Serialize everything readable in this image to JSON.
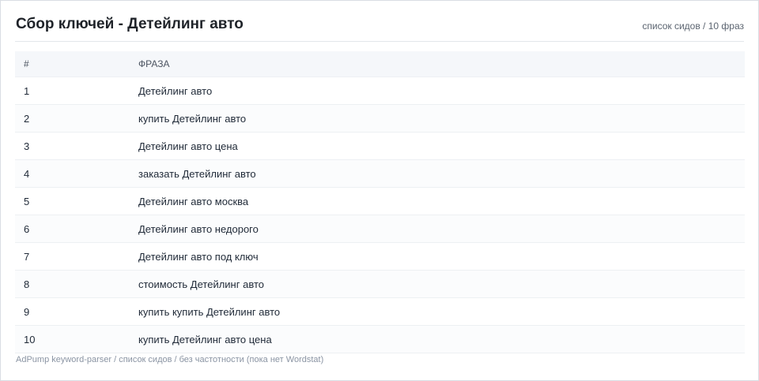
{
  "header": {
    "title": "Сбор ключей - Детейлинг авто",
    "meta": "список сидов / 10 фраз"
  },
  "table": {
    "columns": [
      "#",
      "ФРАЗА"
    ],
    "rows": [
      {
        "num": "1",
        "phrase": "Детейлинг авто"
      },
      {
        "num": "2",
        "phrase": "купить Детейлинг авто"
      },
      {
        "num": "3",
        "phrase": "Детейлинг авто цена"
      },
      {
        "num": "4",
        "phrase": "заказать Детейлинг авто"
      },
      {
        "num": "5",
        "phrase": "Детейлинг авто москва"
      },
      {
        "num": "6",
        "phrase": "Детейлинг авто недорого"
      },
      {
        "num": "7",
        "phrase": "Детейлинг авто под ключ"
      },
      {
        "num": "8",
        "phrase": "стоимость Детейлинг авто"
      },
      {
        "num": "9",
        "phrase": "купить купить Детейлинг авто"
      },
      {
        "num": "10",
        "phrase": "купить Детейлинг авто цена"
      }
    ]
  },
  "footer": {
    "text": "AdPump keyword-parser / список сидов / без частотности (пока нет Wordstat)"
  }
}
